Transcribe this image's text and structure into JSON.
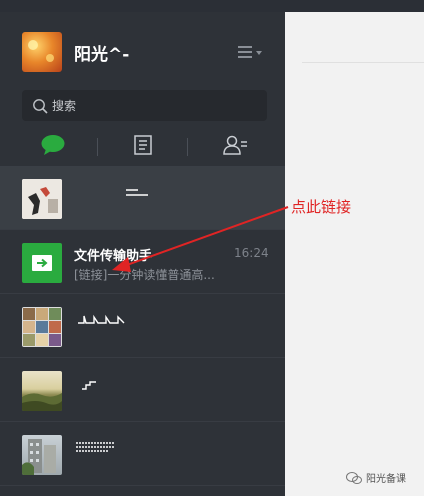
{
  "profile": {
    "name": "阳光^-"
  },
  "search": {
    "placeholder": "搜索"
  },
  "tabs": [
    {
      "icon": "chat-bubble-icon",
      "active": true
    },
    {
      "icon": "document-list-icon",
      "active": false
    },
    {
      "icon": "contacts-icon",
      "active": false
    }
  ],
  "chats": [
    {
      "name": "",
      "preview": "",
      "time": ""
    },
    {
      "name": "文件传输助手",
      "preview": "[链接]一分钟读懂普通高...",
      "time": "16:24"
    },
    {
      "name": "",
      "preview": "",
      "time": ""
    },
    {
      "name": "",
      "preview": "",
      "time": ""
    },
    {
      "name": "",
      "preview": "",
      "time": ""
    }
  ],
  "annotation": {
    "text": "点此链接",
    "color": "#e02424"
  },
  "watermark": {
    "text": "阳光备课"
  },
  "colors": {
    "sidebar": "#2e3238",
    "accent_green": "#2aab3f",
    "background": "#f2f2f2"
  }
}
